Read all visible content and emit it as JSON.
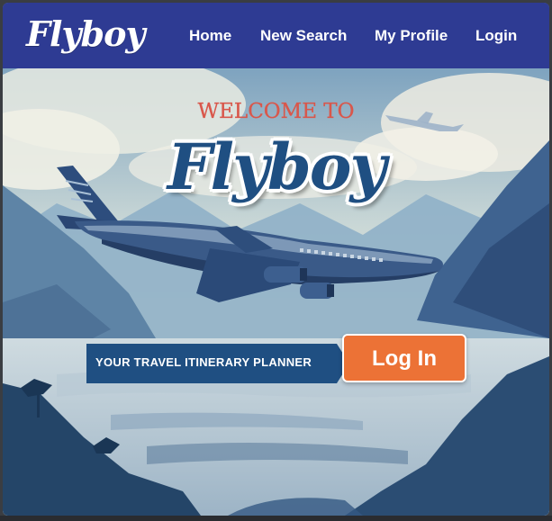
{
  "navbar": {
    "brand": "Flyboy",
    "links": [
      {
        "label": "Home"
      },
      {
        "label": "New Search"
      },
      {
        "label": "My Profile"
      },
      {
        "label": "Login"
      }
    ]
  },
  "hero": {
    "welcome": "WELCOME TO",
    "title": "Flyboy",
    "tagline": "YOUR TRAVEL ITINERARY PLANNER",
    "login_button": "Log In"
  },
  "colors": {
    "navbar_bg": "#2e3b93",
    "accent_orange": "#ec7236",
    "title_blue": "#1f4f82",
    "welcome_red": "#d9574b",
    "tagline_bg": "#1f4f82"
  },
  "icons": [
    "airplane-illustration",
    "distant-plane-illustration"
  ]
}
